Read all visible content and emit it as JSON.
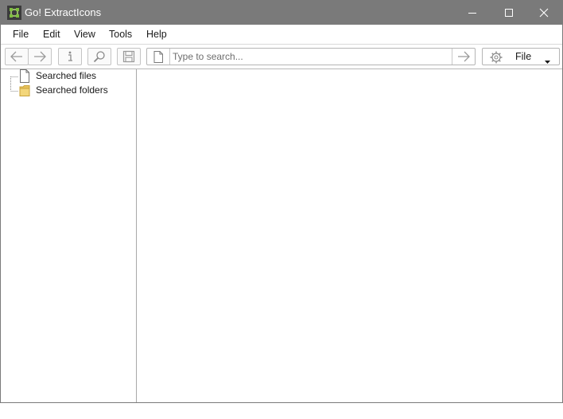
{
  "window": {
    "title": "Go! ExtractIcons"
  },
  "menu": {
    "items": [
      "File",
      "Edit",
      "View",
      "Tools",
      "Help"
    ]
  },
  "toolbar": {
    "icons": [
      "back-arrow-icon",
      "forward-arrow-icon",
      "info-icon",
      "search-magnifier-icon",
      "save-icon"
    ],
    "search": {
      "placeholder": "Type to search...",
      "value": ""
    },
    "mode": {
      "label": "File"
    }
  },
  "tree": {
    "items": [
      {
        "label": "Searched files",
        "icon": "document-icon"
      },
      {
        "label": "Searched folders",
        "icon": "folder-icon"
      }
    ]
  },
  "colors": {
    "titlebar": "#7a7a7a",
    "folder": "#f3d67a"
  }
}
